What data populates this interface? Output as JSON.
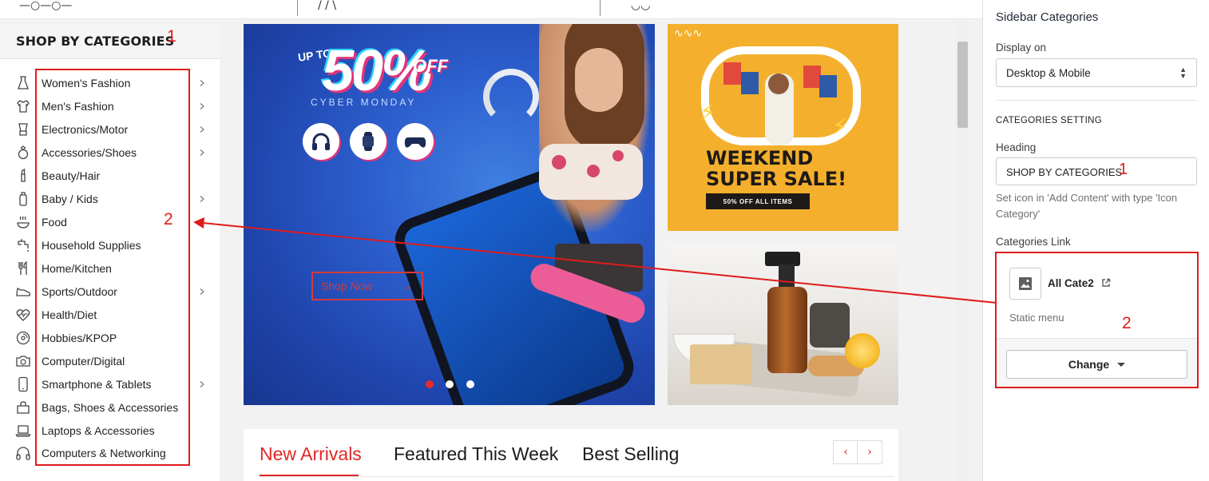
{
  "storefront": {
    "sidebar": {
      "title": "SHOP BY CATEGORIES",
      "categories": [
        {
          "label": "Women's Fashion",
          "icon": "dress-icon",
          "has_submenu": true
        },
        {
          "label": "Men's Fashion",
          "icon": "shirt-icon",
          "has_submenu": true
        },
        {
          "label": "Electronics/Motor",
          "icon": "blender-icon",
          "has_submenu": true
        },
        {
          "label": "Accessories/Shoes",
          "icon": "ring-icon",
          "has_submenu": true
        },
        {
          "label": "Beauty/Hair",
          "icon": "lipstick-icon",
          "has_submenu": false
        },
        {
          "label": "Baby / Kids",
          "icon": "baby-bottle-icon",
          "has_submenu": true
        },
        {
          "label": "Food",
          "icon": "hot-bowl-icon",
          "has_submenu": false
        },
        {
          "label": "Household Supplies",
          "icon": "tap-icon",
          "has_submenu": false
        },
        {
          "label": "Home/Kitchen",
          "icon": "cutlery-icon",
          "has_submenu": false
        },
        {
          "label": "Sports/Outdoor",
          "icon": "sneaker-icon",
          "has_submenu": true
        },
        {
          "label": "Health/Diet",
          "icon": "heartbeat-icon",
          "has_submenu": false
        },
        {
          "label": "Hobbies/KPOP",
          "icon": "vinyl-record-icon",
          "has_submenu": false
        },
        {
          "label": "Computer/Digital",
          "icon": "camera-icon",
          "has_submenu": false
        },
        {
          "label": "Smartphone & Tablets",
          "icon": "smartphone-icon",
          "has_submenu": true
        },
        {
          "label": "Bags, Shoes & Accessories",
          "icon": "bag-icon",
          "has_submenu": false
        },
        {
          "label": "Laptops & Accessories",
          "icon": "laptop-icon",
          "has_submenu": false
        },
        {
          "label": "Computers & Networking",
          "icon": "headphones-icon",
          "has_submenu": false
        }
      ]
    },
    "hero": {
      "upto": "UP TO",
      "percent": "50%",
      "off": "OFF",
      "subtitle": "CYBER MONDAY",
      "cta": "Shop Now",
      "slides": 3,
      "active_slide": 1
    },
    "promo": {
      "line1": "WEEKEND",
      "line2": "SUPER SALE!",
      "badge": "50% OFF ALL ITEMS"
    },
    "tabs": [
      "New Arrivals",
      "Featured This Week",
      "Best Selling"
    ],
    "active_tab": "New Arrivals",
    "prev_symbol": "‹",
    "next_symbol": "›"
  },
  "annotations": {
    "marker_1": "1",
    "marker_2": "2",
    "color": "#e01b1b"
  },
  "editor": {
    "title": "Sidebar Categories",
    "display_on_label": "Display on",
    "display_on_value": "Desktop & Mobile",
    "section_title": "CATEGORIES SETTING",
    "heading_label": "Heading",
    "heading_value": "SHOP BY CATEGORIES",
    "help_text": "Set icon in 'Add Content' with type 'Icon Category'",
    "categories_link_label": "Categories Link",
    "link_name": "All Cate2",
    "link_type": "Static menu",
    "change_button": "Change"
  },
  "colors": {
    "accent_red": "#e02727",
    "promo_yellow": "#f4b02d",
    "hero_blue": "#2d5fce"
  }
}
